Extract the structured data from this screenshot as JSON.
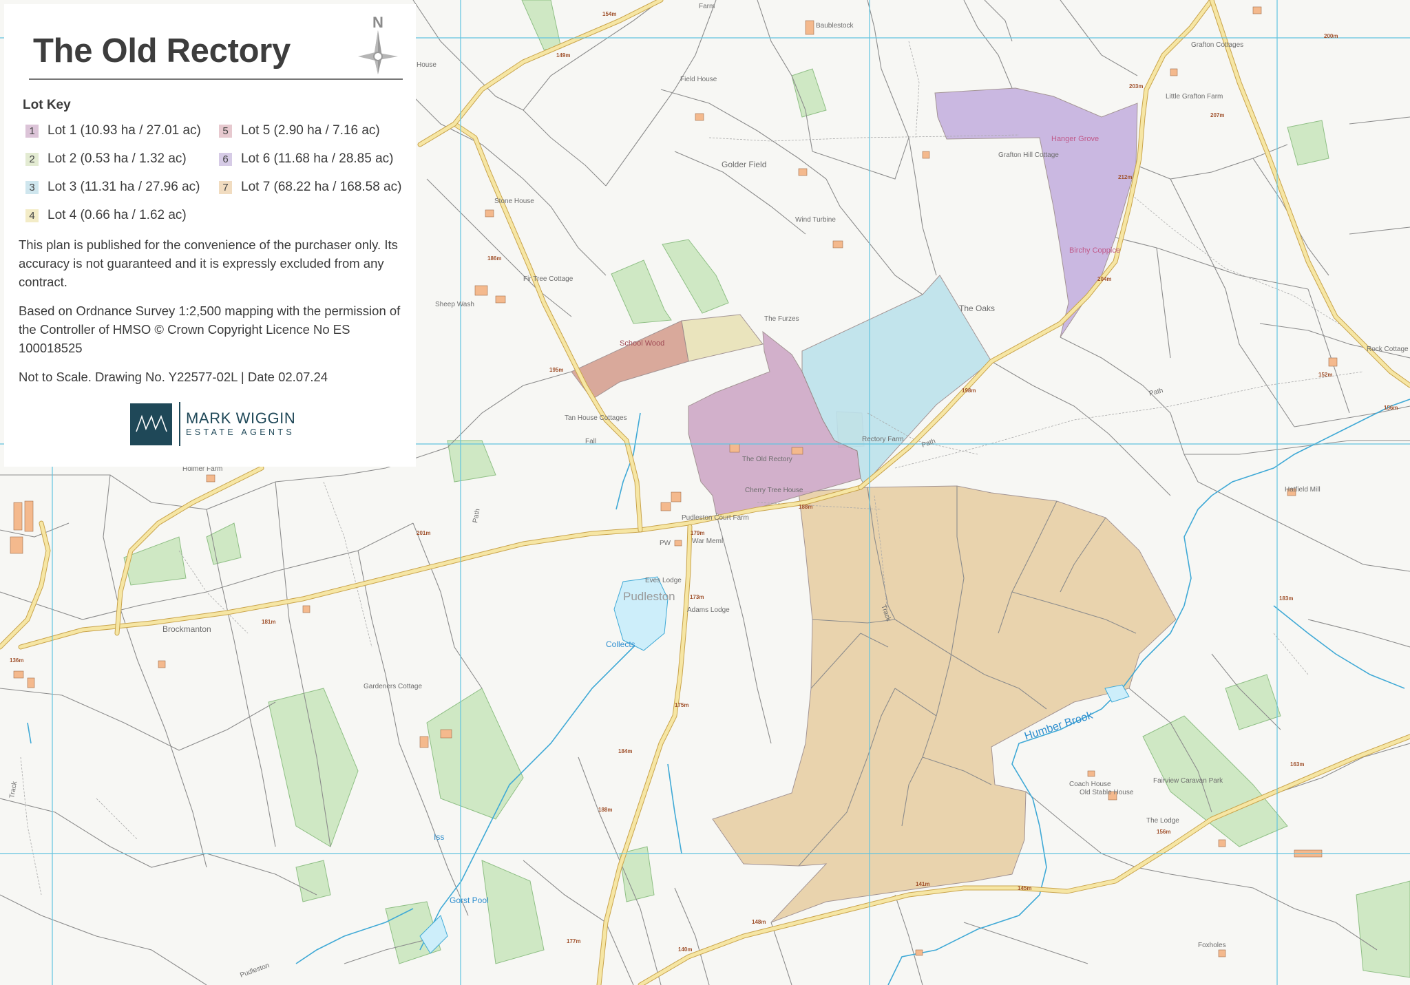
{
  "title": "The Old Rectory",
  "north_label": "N",
  "lot_key": {
    "heading": "Lot Key",
    "lots": [
      {
        "number": "1",
        "text": "Lot 1 (10.93 ha / 27.01 ac)",
        "color": "#dcc4d8"
      },
      {
        "number": "2",
        "text": "Lot 2 (0.53 ha / 1.32 ac)",
        "color": "#e3ebd2"
      },
      {
        "number": "3",
        "text": "Lot 3 (11.31 ha / 27.96 ac)",
        "color": "#cfe6ee"
      },
      {
        "number": "4",
        "text": "Lot 4 (0.66 ha / 1.62 ac)",
        "color": "#f3ecc7"
      },
      {
        "number": "5",
        "text": "Lot 5 (2.90 ha / 7.16 ac)",
        "color": "#e7c9cf"
      },
      {
        "number": "6",
        "text": "Lot 6 (11.68 ha / 28.85 ac)",
        "color": "#d6cbe6"
      },
      {
        "number": "7",
        "text": "Lot 7 (68.22 ha / 168.58 ac)",
        "color": "#f1dcc0"
      }
    ]
  },
  "notes": {
    "disclaimer": "This plan is published for the convenience of the purchaser only. Its accuracy is not guaranteed and it is expressly excluded from any contract.",
    "copyright": "Based on Ordnance Survey 1:2,500 mapping with the permission of the Controller of HMSO © Crown Copyright Licence No ES 100018525",
    "drawing": "Not to Scale. Drawing No. Y22577-02L | Date 02.07.24"
  },
  "logo": {
    "mark": "MW",
    "name": "MARK WIGGIN",
    "subtitle": "ESTATE AGENTS",
    "color": "#1f4858"
  },
  "map": {
    "lot_colors": {
      "lot1": "#cfa9c7",
      "lot2": "#e9e3b8",
      "lot3": "#bde2ec",
      "lot4": "#e9e3b8",
      "lot5": "#d6a192",
      "lot6": "#c6b2e0",
      "lot7": "#e8d0a6"
    },
    "labels": {
      "the_old_rectory": "The Old Rectory",
      "cherry_tree_house": "Cherry Tree House",
      "rectory_farm": "Rectory Farm",
      "school_wood": "School Wood",
      "the_furzes": "The Furzes",
      "the_oaks": "The Oaks",
      "hanger_grove": "Hanger Grove",
      "birchy_coppice": "Birchy Coppice",
      "grafton_hill_cottage": "Grafton Hill Cottage",
      "golder_field": "Golder Field",
      "wind_turbine": "Wind Turbine",
      "field_house": "Field House",
      "baublestock": "Baublestock",
      "stone_house": "Stone House",
      "fir_tree_cottage": "Fir Tree Cottage",
      "sheep_wash": "Sheep Wash",
      "tan_house_cottages": "Tan House Cottages",
      "pudleston_court_farm": "Pudleston Court Farm",
      "war_memorial": "War Meml",
      "pw": "PW",
      "eves_lodge": "Eves Lodge",
      "pudleston": "Pudleston",
      "adams_lodge": "Adams Lodge",
      "collects": "Collects",
      "brockmanton": "Brockmanton",
      "gardeners_cottage": "Gardeners Cottage",
      "gorst_pool": "Gorst Pool",
      "humber_brook": "Humber Brook",
      "coach_house": "Coach House",
      "old_stable_house": "Old Stable House",
      "fairview_caravan_park": "Fairview Caravan Park",
      "the_lodge": "The Lodge",
      "hatfield_mill": "Hatfield Mill",
      "rock_cottage": "Rock Cottage",
      "grafton_cottages": "Grafton Cottages",
      "little_grafton_farm": "Little Grafton Farm",
      "holmer_farm": "Holmer Farm",
      "foxholes": "Foxholes",
      "farm": "Farm",
      "house": "House",
      "track": "Track",
      "path": "Path",
      "iss": "Iss",
      "fall": "Fall",
      "pudleston_bottom": "Pudleston"
    },
    "spot_heights": [
      "154m",
      "149m",
      "186m",
      "195m",
      "201m",
      "181m",
      "136m",
      "179m",
      "173m",
      "175m",
      "184m",
      "188m",
      "177m",
      "148m",
      "140m",
      "141m",
      "145m",
      "198m",
      "188m",
      "203m",
      "207m",
      "212m",
      "204m",
      "200m",
      "183m",
      "163m",
      "156m",
      "152m",
      "156m"
    ]
  }
}
